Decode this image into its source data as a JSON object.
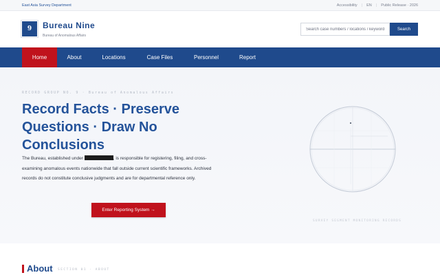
{
  "topbar": {
    "department": "East Asia Survey Department",
    "accessibility": "Accessibility",
    "language": "EN",
    "release": "Public Release · 2026"
  },
  "brand": {
    "logo_numeral": "9",
    "title": "Bureau Nine",
    "subtitle": "Bureau of Anomalous Affairs"
  },
  "search": {
    "placeholder": "Search case numbers / locations / keywords",
    "button_label": "Search"
  },
  "nav": {
    "items": [
      {
        "label": "Home",
        "active": true
      },
      {
        "label": "About"
      },
      {
        "label": "Locations"
      },
      {
        "label": "Case Files"
      },
      {
        "label": "Personnel"
      },
      {
        "label": "Report"
      }
    ]
  },
  "hero": {
    "eyebrow": "RECORD GROUP NO. 9 · Bureau of Anomalous Affairs",
    "title": "Record Facts · Preserve Questions · Draw No Conclusions",
    "body_before": "The Bureau, established under",
    "body_after": ", is responsible for registering, filing, and cross-examining anomalous events nationwide that fall outside current scientific frameworks. Archived records do not constitute conclusive judgments and are for departmental reference only.",
    "cta_label": "Enter Reporting System →",
    "diagram_caption": "SURVEY SEGMENT MONITORING RECORDS"
  },
  "about": {
    "title": "About",
    "section_tag": "SECTION 01 · ABOUT"
  },
  "colors": {
    "primary": "#1f4a8c",
    "accent": "#c0121c",
    "hero_bg": "#f3f5f9"
  }
}
